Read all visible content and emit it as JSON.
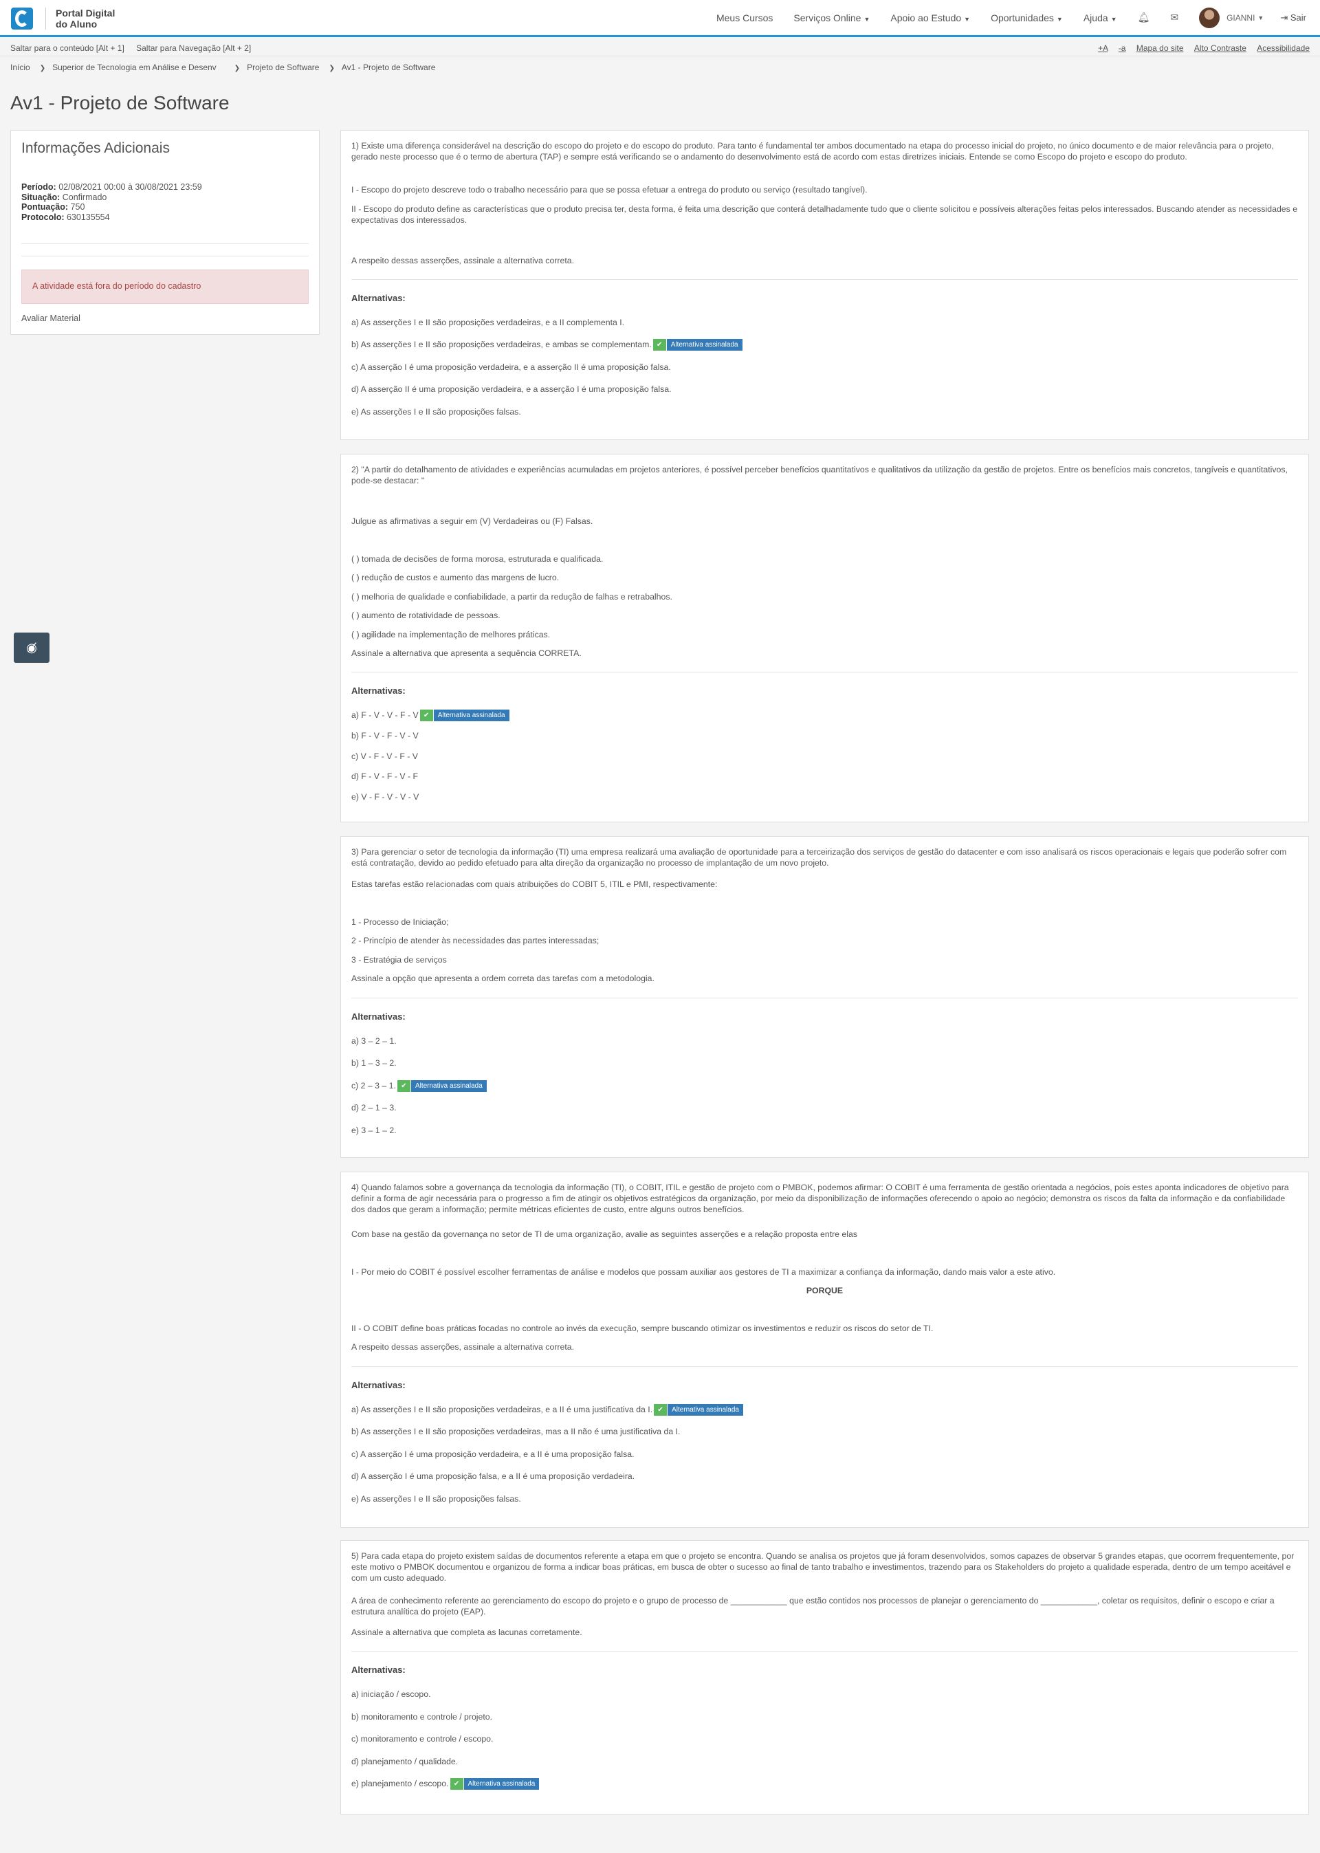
{
  "brand": {
    "line1": "Portal Digital",
    "line2": "do Aluno"
  },
  "nav": {
    "courses": "Meus Cursos",
    "services": "Serviços Online",
    "support": "Apoio ao Estudo",
    "opps": "Oportunidades",
    "help": "Ajuda",
    "user": "GIANNI",
    "logout": "Sair"
  },
  "skip": {
    "content": "Saltar para o conteúdo [Alt + 1]",
    "nav": "Saltar para Navegação [Alt + 2]",
    "plus": "+A",
    "minus": "-a",
    "map": "Mapa do site",
    "contrast": "Alto Contraste",
    "access": "Acessibilidade"
  },
  "breadcrumb": [
    "Início",
    "Superior de Tecnologia em Análise e Desenv",
    "Projeto de Software",
    "Av1 - Projeto de Software"
  ],
  "title": "Av1 - Projeto de Software",
  "side": {
    "heading": "Informações Adicionais",
    "period_label": "Período:",
    "period": "02/08/2021 00:00 à 30/08/2021 23:59",
    "status_label": "Situação:",
    "status": "Confirmado",
    "score_label": "Pontuação:",
    "score": "750",
    "protocol_label": "Protocolo:",
    "protocol": "630135554",
    "alert": "A atividade está fora do período do cadastro",
    "material": "Avaliar Material"
  },
  "alt_heading": "Alternativas:",
  "badge": "Alternativa assinalada",
  "q1": {
    "p1": "1)  Existe uma diferença considerável na descrição do escopo do projeto e do escopo do produto. Para tanto é fundamental ter ambos documentado na etapa do processo inicial do projeto, no único documento e de maior relevância para o projeto, gerado neste processo que é o termo de abertura (TAP) e sempre está verificando se o andamento do desenvolvimento está de acordo com estas diretrizes iniciais. Entende se como Escopo do projeto e escopo do produto.",
    "p2": "I - Escopo do projeto descreve todo o trabalho necessário para que se possa efetuar a entrega do produto ou serviço (resultado tangível).",
    "p3": "II - Escopo do produto define as características que o produto precisa ter, desta forma, é feita uma descrição que conterá detalhadamente tudo que o cliente solicitou e possíveis alterações feitas pelos interessados. Buscando atender as necessidades e expectativas dos interessados.",
    "p4": "A respeito dessas asserções, assinale a alternativa correta.",
    "a": "a)  As asserções I e II são proposições verdadeiras, e a II complementa I.",
    "b": "b)  As asserções I e II são proposições verdadeiras, e ambas se complementam.",
    "c": "c)  A asserção I é uma proposição verdadeira, e a asserção II é uma proposição falsa.",
    "d": "d)  A asserção II é uma proposição verdadeira, e a asserção I é uma proposição falsa.",
    "e": "e)  As asserções I e II são proposições falsas."
  },
  "q2": {
    "p1": "2)  \"A partir do detalhamento de atividades e experiências acumuladas em projetos anteriores, é possível perceber benefícios quantitativos e qualitativos da utilização  da gestão de projetos. Entre os benefícios mais concretos, tangíveis e quantitativos, pode-se destacar: \"",
    "p2": "Julgue as afirmativas a seguir em (V) Verdadeiras ou (F) Falsas.",
    "l1": "(   ) tomada de decisões de forma morosa, estruturada e qualificada.",
    "l2": "(   ) redução de custos e aumento das margens de lucro.",
    "l3": "(   ) melhoria de qualidade e confiabilidade, a partir da redução de falhas e retrabalhos.",
    "l4": "(   ) aumento de rotatividade de pessoas.",
    "l5": "(   ) agilidade na implementação de melhores práticas.",
    "p3": "Assinale a alternativa que apresenta a sequência CORRETA.",
    "a": "a)  F - V - V - F - V",
    "b": "b)  F - V - F - V - V",
    "c": "c)  V - F - V - F - V",
    "d": "d)  F - V - F - V - F",
    "e": "e)  V - F - V - V - V"
  },
  "q3": {
    "p1": "3)   Para gerenciar o setor de tecnologia da informação (TI) uma empresa realizará uma avaliação de oportunidade para a terceirização dos serviços de gestão do datacenter e com isso analisará os riscos operacionais e legais que poderão sofrer com está contratação, devido ao pedido efetuado para alta direção da organização no processo de implantação de um novo projeto.",
    "p2": "Estas tarefas estão relacionadas com quais atribuições do COBIT 5, ITIL e PMI, respectivamente:",
    "l1": "1 - Processo de Iniciação;",
    "l2": "2 - Princípio de atender às necessidades das partes interessadas;",
    "l3": "3 - Estratégia de serviços",
    "p3": "Assinale a opção que apresenta a ordem correta das tarefas com a metodologia.",
    "a": "a)  3 – 2 – 1.",
    "b": "b)  1 – 3 – 2.",
    "c": "c)  2 – 3 – 1.",
    "d": "d)  2 – 1 – 3.",
    "e": "e)  3 – 1 – 2."
  },
  "q4": {
    "p1": "4)  Quando falamos sobre a governança da tecnologia da informação (TI), o COBIT, ITIL e gestão de projeto com o PMBOK, podemos afirmar: O COBIT é uma ferramenta de gestão orientada a negócios, pois estes aponta indicadores de objetivo para definir a forma de agir necessária para o progresso a fim de atingir os objetivos estratégicos da organização, por meio da disponibilização de informações oferecendo o apoio ao negócio; demonstra os riscos da falta da informação e da confiabilidade dos dados que geram a informação; permite métricas eficientes de custo, entre alguns outros benefícios.",
    "p2": "Com base na gestão da governança no setor de TI de uma organização, avalie as seguintes asserções e a relação proposta entre elas",
    "p3": "I - Por meio do COBIT é possível escolher ferramentas de análise e modelos que possam auxiliar aos gestores de TI a maximizar a confiança da informação, dando mais valor a este ativo.",
    "porque": "PORQUE",
    "p4": "II - O COBIT define boas práticas focadas no controle ao invés da execução, sempre buscando otimizar os investimentos e reduzir os riscos do setor de TI.",
    "p5": "A respeito dessas asserções, assinale a alternativa correta.",
    "a": "a)  As asserções I e II são proposições verdadeiras, e a II é uma justificativa da I.",
    "b": "b)  As asserções I e II são proposições verdadeiras, mas a II não é uma justificativa da I.",
    "c": "c)  A asserção I é uma proposição verdadeira, e a II é uma proposição falsa.",
    "d": "d)  A asserção I é uma proposição falsa, e a II é uma proposição verdadeira.",
    "e": "e)  As asserções I e II são proposições falsas."
  },
  "q5": {
    "p1": "5)  Para cada etapa do projeto existem saídas de documentos referente a etapa em que o projeto se encontra. Quando se analisa os projetos que já foram desenvolvidos, somos capazes de observar 5 grandes etapas, que ocorrem frequentemente, por este motivo o PMBOK documentou e organizou de forma a indicar boas práticas, em busca de obter o sucesso ao final de tanto trabalho e investimentos, trazendo para os Stakeholders do projeto a qualidade esperada, dentro de um tempo aceitável e com um custo adequado.",
    "p2": "A área de conhecimento referente ao gerenciamento do escopo do projeto e o grupo de processo de ____________ que estão contidos nos processos de planejar o gerenciamento do ____________, coletar os requisitos, definir o escopo e criar a estrutura analítica do projeto (EAP).",
    "p3": "Assinale a alternativa que completa as lacunas corretamente.",
    "a": "a)  iniciação / escopo.",
    "b": "b)  monitoramento e controle / projeto.",
    "c": "c)  monitoramento e controle / escopo.",
    "d": "d)  planejamento / qualidade.",
    "e": "e)  planejamento / escopo."
  }
}
